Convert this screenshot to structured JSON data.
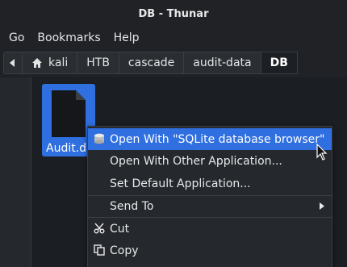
{
  "window": {
    "title": "DB - Thunar"
  },
  "menubar": {
    "items": [
      "Go",
      "Bookmarks",
      "Help"
    ]
  },
  "pathbar": {
    "crumbs": [
      "kali",
      "HTB",
      "cascade",
      "audit-data",
      "DB"
    ],
    "active": "DB"
  },
  "file": {
    "name": "Audit.db"
  },
  "context_menu": {
    "items": [
      {
        "label": "Open With \"SQLite database browser\"",
        "icon": "sqlite-db-icon",
        "highlighted": true
      },
      {
        "label": "Open With Other Application...",
        "icon": ""
      },
      {
        "label": "Set Default Application...",
        "icon": ""
      },
      {
        "label": "Send To",
        "icon": "",
        "submenu": true
      },
      {
        "label": "Cut",
        "icon": "scissors-icon"
      },
      {
        "label": "Copy",
        "icon": "copy-icon"
      }
    ]
  },
  "colors": {
    "accent": "#2f6fe0",
    "background": "#1b1e22"
  }
}
